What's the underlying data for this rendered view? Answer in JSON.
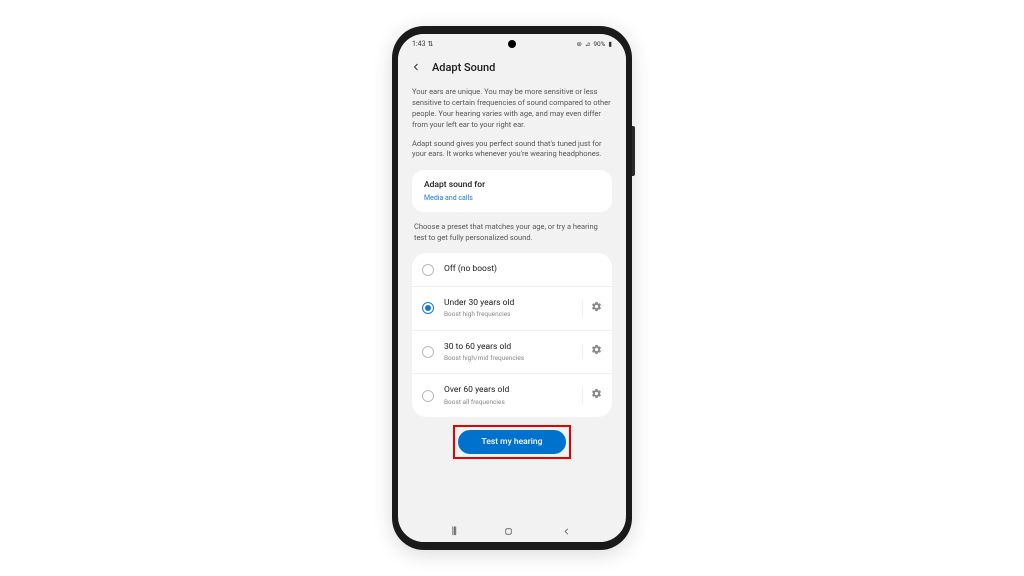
{
  "status_bar": {
    "time": "1:43",
    "signal_icon": "⇅",
    "wifi": "⊚",
    "network": "⊿",
    "battery_pct": "90%",
    "battery_icon": "▮"
  },
  "header": {
    "title": "Adapt Sound"
  },
  "body": {
    "description": "Your ears are unique. You may be more sensitive or less sensitive to certain frequencies of sound compared to other people. Your hearing varies with age, and may even differ from your left ear to your right ear.",
    "subdescription": "Adapt sound gives you perfect sound that's tuned just for your ears. It works whenever you're wearing headphones.",
    "adapt_for": {
      "title": "Adapt sound for",
      "value": "Media and calls"
    },
    "preset_hint": "Choose a preset that matches your age, or try a hearing test to get fully personalized sound.",
    "presets": [
      {
        "label": "Off (no boost)",
        "sub": "",
        "selected": false,
        "has_gear": false
      },
      {
        "label": "Under 30 years old",
        "sub": "Boost high frequencies",
        "selected": true,
        "has_gear": true
      },
      {
        "label": "30 to 60 years old",
        "sub": "Boost high/mid frequencies",
        "selected": false,
        "has_gear": true
      },
      {
        "label": "Over 60 years old",
        "sub": "Boost all frequencies",
        "selected": false,
        "has_gear": true
      }
    ],
    "test_button": "Test my hearing"
  }
}
